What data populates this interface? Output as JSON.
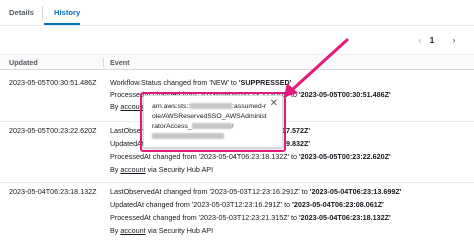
{
  "tabs": [
    {
      "label": "Details"
    },
    {
      "label": "History"
    }
  ],
  "pager": {
    "prev": "‹",
    "page": "1",
    "next": "›"
  },
  "table": {
    "headers": {
      "updated": "Updated",
      "event": "Event"
    },
    "rows": [
      {
        "time": "2023-05-05T00:30:51.486Z",
        "line1": {
          "text": "Workflow.Status changed from 'NEW' to ",
          "bold": "'SUPPRESSED'"
        },
        "line2": {
          "text": "ProcessedAt changed from '2023-05-05T00:23:22.620Z' to ",
          "bold": "'2023-05-05T00:30:51.486Z'"
        },
        "line3": {
          "by": "By ",
          "link": "account",
          "via": " via"
        }
      },
      {
        "time": "2023-05-05T00:23:22.620Z",
        "line1": {
          "text": "LastObservedAt",
          "bold": "17.572Z'"
        },
        "line2": {
          "text": "UpdatedAt chang",
          "bold": "9.832Z'"
        },
        "line3": {
          "text": "ProcessedAt changed from '2023-05-04T06:23:18.132Z' to ",
          "bold": "'2023-05-05T00:23:22.620Z'"
        },
        "line4": {
          "by": "By ",
          "link": "account",
          "via": " via Security Hub API"
        }
      },
      {
        "time": "2023-05-04T06:23:18.132Z",
        "line1": {
          "text": "LastObservedAt changed from '2023-05-03T12:23:16.291Z' to ",
          "bold": "'2023-05-04T06:23:13.699Z'"
        },
        "line2": {
          "text": "UpdatedAt changed from '2023-05-03T12:23:16.291Z' to ",
          "bold": "'2023-05-04T06:23:08.061Z'"
        },
        "line3": {
          "text": "ProcessedAt changed from '2023-05-03T12:23:21.315Z' to ",
          "bold": "'2023-05-04T06:23:18.132Z'"
        },
        "line4": {
          "by": "By ",
          "link": "account",
          "via": " via Security Hub API"
        }
      }
    ]
  },
  "popover": {
    "part1": "arn:aws:sts::",
    "part2": ":assumed-role/AWSReservedSSO_AWSAdministratorAccess_",
    "part3": "/",
    "close": "✕"
  },
  "colors": {
    "highlight": "#e5197b",
    "accent": "#0073bb"
  }
}
